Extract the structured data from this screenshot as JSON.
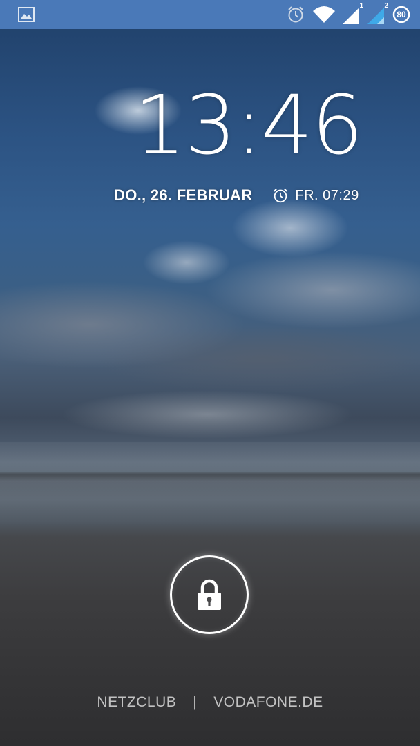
{
  "status_bar": {
    "background": "#4a79b8",
    "icons": [
      "gallery-notification-icon",
      "alarm-clock-icon",
      "wifi-icon",
      "signal-sim1-icon",
      "signal-sim2-icon",
      "battery-icon"
    ],
    "sim1_label": "1",
    "sim2_label": "2",
    "battery_level": "80"
  },
  "lockscreen": {
    "time": "13:46",
    "date": "DO., 26. FEBRUAR",
    "next_alarm": "FR. 07:29",
    "unlock_icon": "lock-icon",
    "carrier_left": "NETZCLUB",
    "carrier_separator": "|",
    "carrier_right": "VODAFONE.DE"
  }
}
